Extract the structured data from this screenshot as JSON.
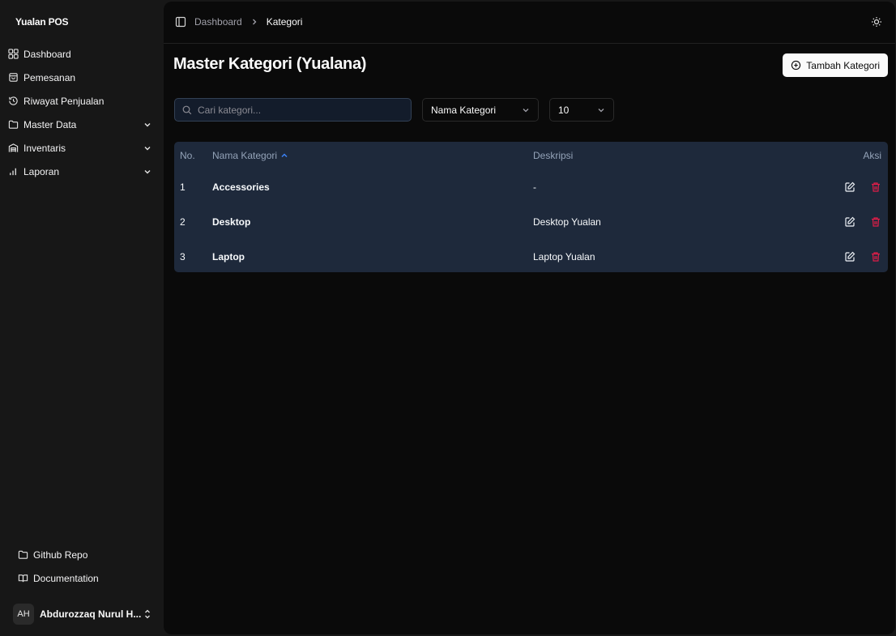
{
  "sidebar": {
    "brand": "Yualan POS",
    "items": [
      {
        "label": "Dashboard"
      },
      {
        "label": "Pemesanan"
      },
      {
        "label": "Riwayat Penjualan"
      },
      {
        "label": "Master Data"
      },
      {
        "label": "Inventaris"
      },
      {
        "label": "Laporan"
      }
    ],
    "bottom": [
      {
        "label": "Github Repo"
      },
      {
        "label": "Documentation"
      }
    ],
    "user": {
      "initials": "AH",
      "name": "Abdurozzaq Nurul H..."
    }
  },
  "breadcrumb": {
    "parent": "Dashboard",
    "current": "Kategori"
  },
  "page": {
    "title": "Master Kategori (Yualana)",
    "add_label": "Tambah Kategori"
  },
  "filters": {
    "search_placeholder": "Cari kategori...",
    "sort_value": "Nama Kategori",
    "page_size_value": "10"
  },
  "table": {
    "headers": {
      "no": "No.",
      "name": "Nama Kategori",
      "description": "Deskripsi",
      "actions": "Aksi"
    },
    "rows": [
      {
        "no": "1",
        "name": "Accessories",
        "description": "-"
      },
      {
        "no": "2",
        "name": "Desktop",
        "description": "Desktop Yualan"
      },
      {
        "no": "3",
        "name": "Laptop",
        "description": "Laptop Yualan"
      }
    ]
  },
  "colors": {
    "sidebar_bg": "#171717",
    "main_bg": "#0a0a0a",
    "table_bg": "#1e293b",
    "sort_accent": "#3b82f6",
    "delete_red": "#e11d48"
  }
}
